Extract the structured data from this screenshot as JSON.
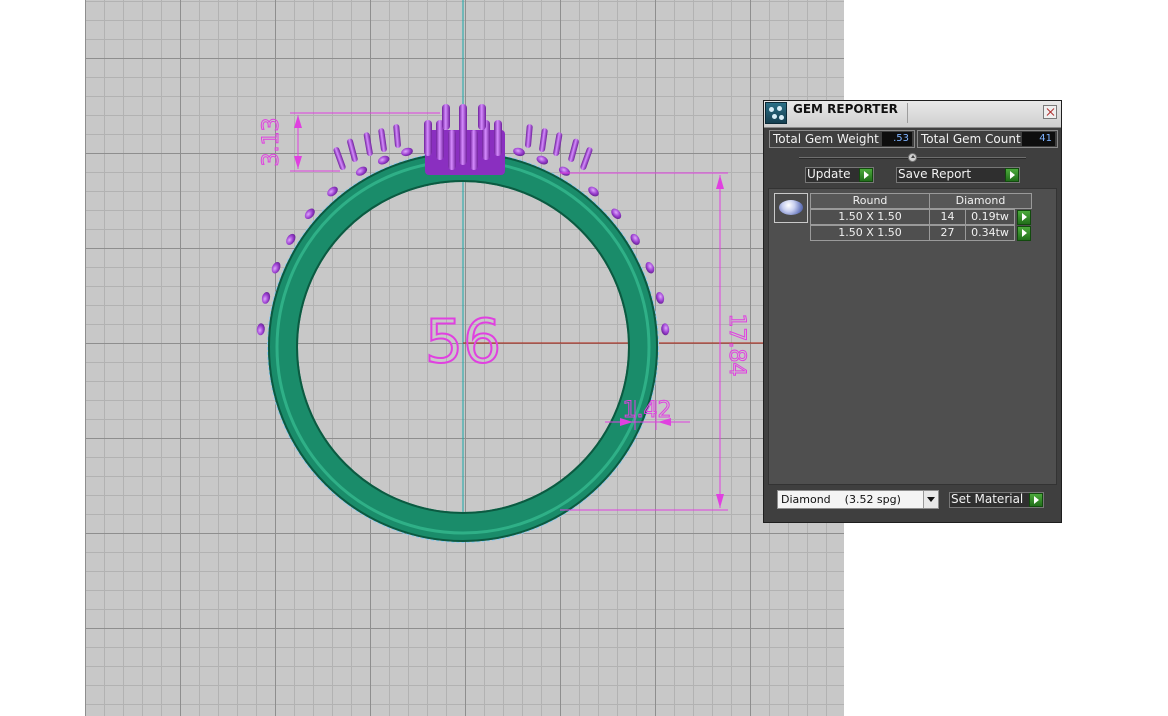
{
  "viewport": {
    "ring_size_label": "56",
    "dimensions": {
      "height_label": "17.84",
      "setting_height_label": "3.13",
      "band_width_label": "1.42"
    },
    "colors": {
      "background": "#c8c8c8",
      "band": "#1a8c6a",
      "gems": "#9a3fcf",
      "dimension_lines": "#e040e0",
      "axis_vertical": "#18a8a8",
      "axis_horizontal": "#b02010"
    }
  },
  "gem_reporter": {
    "title": "GEM REPORTER",
    "close_icon": "close-icon",
    "total_weight_label": "Total Gem Weight",
    "total_weight_value": ".53",
    "total_count_label": "Total Gem Count",
    "total_count_value": "41",
    "update_label": "Update",
    "save_report_label": "Save Report",
    "table": {
      "headers": [
        "Round",
        "Diamond"
      ],
      "rows": [
        {
          "size": "1.50 X 1.50",
          "count": "14",
          "weight": "0.19tw"
        },
        {
          "size": "1.50 X 1.50",
          "count": "27",
          "weight": "0.34tw"
        }
      ]
    },
    "material_value": "Diamond    (3.52 spg)",
    "set_material_label": "Set Material"
  }
}
